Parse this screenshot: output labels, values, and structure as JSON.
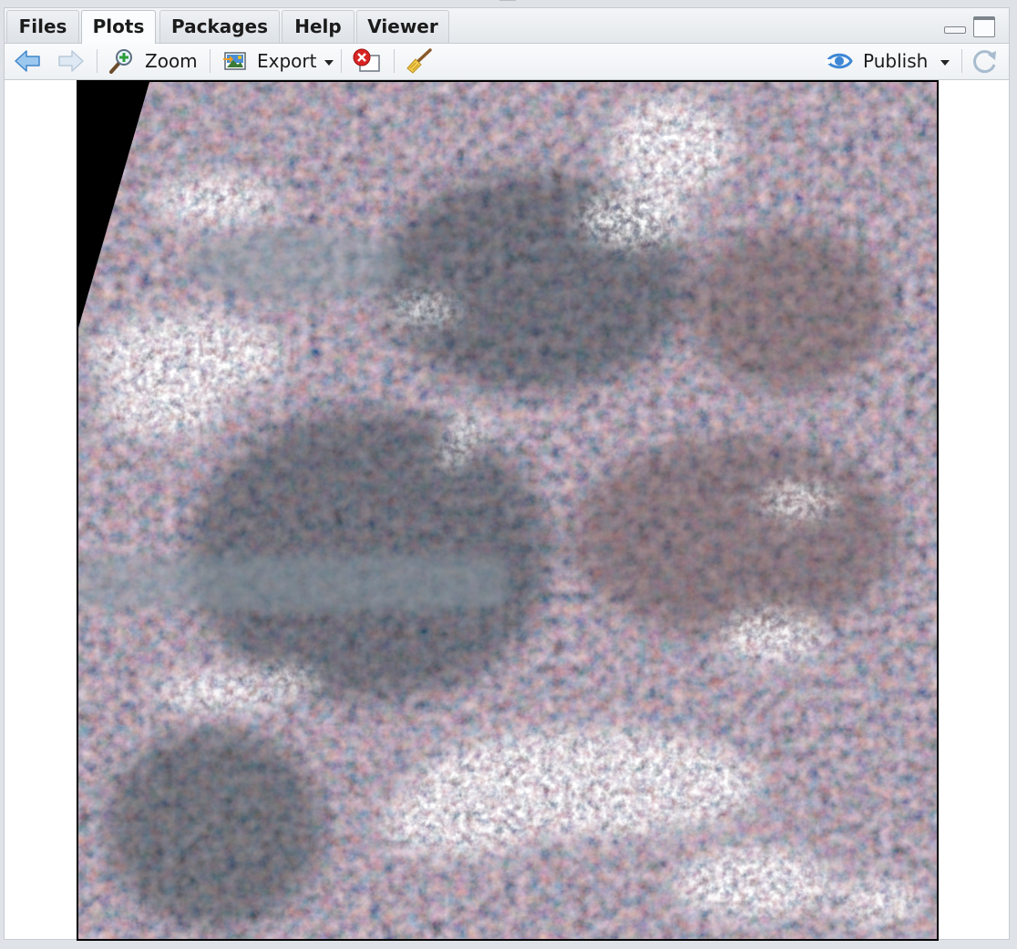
{
  "tabs": [
    {
      "label": "Files"
    },
    {
      "label": "Plots"
    },
    {
      "label": "Packages"
    },
    {
      "label": "Help"
    },
    {
      "label": "Viewer"
    }
  ],
  "active_tab": "Plots",
  "toolbar": {
    "back_icon": "left-arrow-icon",
    "forward_icon": "right-arrow-icon",
    "zoom_label": "Zoom",
    "zoom_icon": "magnifier-plus-icon",
    "export_label": "Export",
    "export_icon": "export-image-icon",
    "remove_icon": "remove-plot-icon",
    "clear_icon": "broom-icon",
    "publish_label": "Publish",
    "publish_icon": "publish-icon",
    "refresh_icon": "refresh-icon"
  },
  "plot": {
    "content": "satellite-rgb-image",
    "palette": {
      "border": "#000000",
      "land_dark": "#2f3a3e",
      "land_brown": "#6a5550",
      "forest": "#2a3c3c",
      "cloud": "#f4f6f8",
      "nodata": "#000000"
    }
  }
}
